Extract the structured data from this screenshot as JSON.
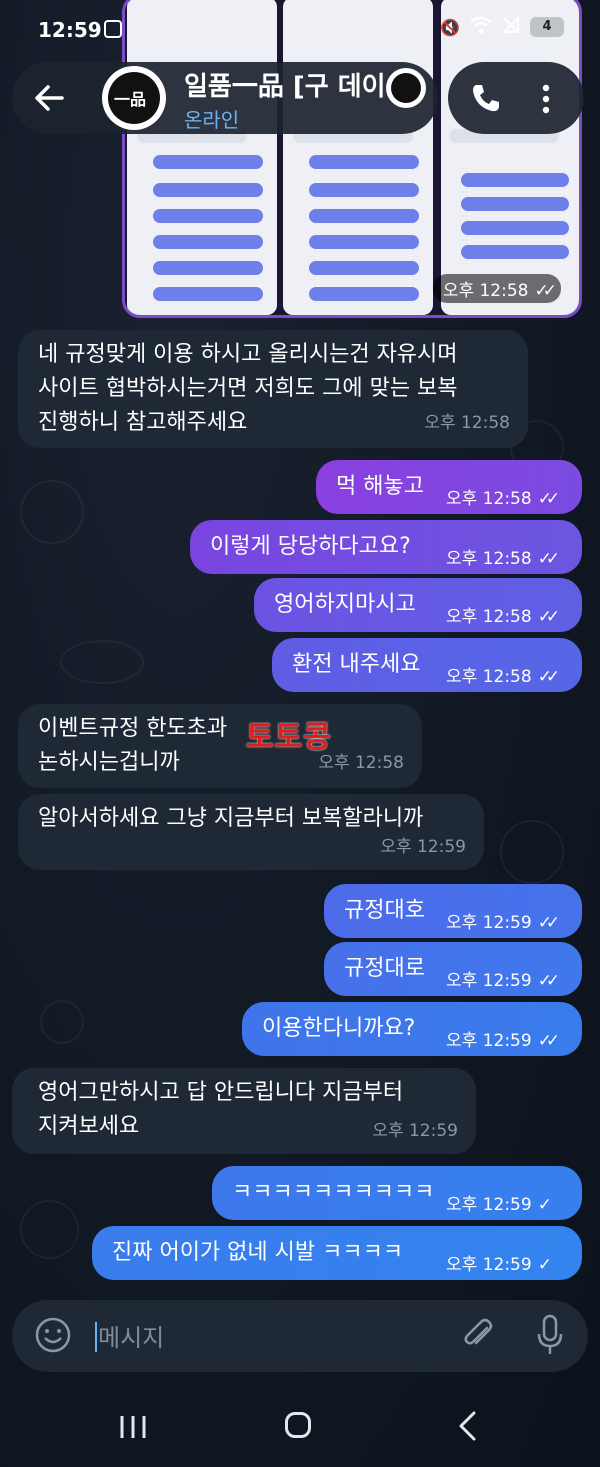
{
  "status_bar": {
    "time": "12:59",
    "battery": "4",
    "net": "6"
  },
  "header": {
    "name": "일품一品 [구 데이",
    "status": "온라인",
    "avatar_text": "一品"
  },
  "image_message": {
    "time": "오후 12:58"
  },
  "messages": [
    {
      "dir": "in",
      "lines": [
        "네 규정맞게 이용 하시고 올리시는건 자유시며",
        "사이트 협박하시는거면 저희도 그에 맞는 보복",
        "진행하니 참고해주세요"
      ],
      "time": "오후 12:58"
    },
    {
      "dir": "out",
      "lines": [
        "먹 해놓고"
      ],
      "time": "오후 12:58",
      "read": true
    },
    {
      "dir": "out",
      "lines": [
        "이렇게 당당하다고요?"
      ],
      "time": "오후 12:58",
      "read": true
    },
    {
      "dir": "out",
      "lines": [
        "영어하지마시고"
      ],
      "time": "오후 12:58",
      "read": true
    },
    {
      "dir": "out",
      "lines": [
        "환전 내주세요"
      ],
      "time": "오후 12:58",
      "read": true
    },
    {
      "dir": "in",
      "lines": [
        "이벤트규정 한도초과",
        "논하시는겁니까"
      ],
      "time": "오후 12:58"
    },
    {
      "dir": "in",
      "lines": [
        "알아서하세요 그냥 지금부터 보복할라니까"
      ],
      "time": "오후 12:59"
    },
    {
      "dir": "out",
      "lines": [
        "규정대호"
      ],
      "time": "오후 12:59",
      "read": true
    },
    {
      "dir": "out",
      "lines": [
        "규정대로"
      ],
      "time": "오후 12:59",
      "read": true
    },
    {
      "dir": "out",
      "lines": [
        "이용한다니까요?"
      ],
      "time": "오후 12:59",
      "read": true
    },
    {
      "dir": "in",
      "lines": [
        "영어그만하시고 답 안드립니다  지금부터",
        "지켜보세요"
      ],
      "time": "오후 12:59"
    },
    {
      "dir": "out",
      "lines": [
        "ㅋㅋㅋㅋㅋㅋㅋㅋㅋㅋ"
      ],
      "time": "오후 12:59",
      "read": false
    },
    {
      "dir": "out",
      "lines": [
        "진짜 어이가 없네 시발 ㅋㅋㅋㅋ"
      ],
      "time": "오후 12:59",
      "read": false
    }
  ],
  "watermark": "토토콩",
  "input": {
    "placeholder": "메시지"
  },
  "colors": {
    "bg": "#0e1621",
    "incoming": "#1f2936",
    "link": "#6ab3f3"
  }
}
